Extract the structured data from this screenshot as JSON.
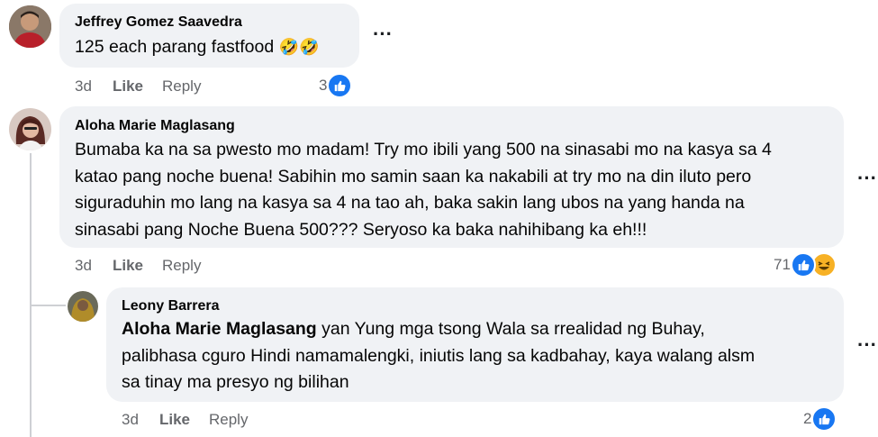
{
  "comments": [
    {
      "author": "Jeffrey Gomez Saavedra",
      "text": "125 each parang fastfood",
      "emojis": "🤣🤣",
      "time": "3d",
      "like_label": "Like",
      "reply_label": "Reply",
      "reaction_count": "3",
      "more_label": "···"
    },
    {
      "author": "Aloha Marie Maglasang",
      "lines": [
        "Bumaba ka na sa pwesto mo madam! Try mo ibili yang 500 na sinasabi mo na kasya sa 4",
        "katao pang noche buena! Sabihin mo samin saan ka nakabili at try mo na din iluto pero",
        "siguraduhin mo lang na kasya sa 4 na tao ah, baka sakin lang ubos na yang handa na",
        "sinasabi pang Noche Buena 500??? Seryoso ka baka nahihibang ka eh!!!"
      ],
      "time": "3d",
      "like_label": "Like",
      "reply_label": "Reply",
      "reaction_count": "71",
      "more_label": "···"
    },
    {
      "author": "Leony Barrera",
      "mention": "Aloha Marie Maglasang",
      "first_line_rest": " yan Yung mga tsong Wala sa rrealidad ng Buhay,",
      "lines": [
        "palibhasa cguro Hindi namamalengki, iniutis lang sa kadbahay, kaya walang alsm",
        "sa tinay ma presyo ng bilihan"
      ],
      "time": "3d",
      "like_label": "Like",
      "reply_label": "Reply",
      "reaction_count": "2",
      "more_label": "···"
    }
  ],
  "colors": {
    "bubble": "#f0f2f5",
    "like_blue": "#1877f2",
    "haha_yellow": "#f7b125",
    "meta_gray": "#65676b"
  },
  "icons": {
    "like": "like-reaction-icon",
    "haha": "haha-reaction-icon"
  }
}
